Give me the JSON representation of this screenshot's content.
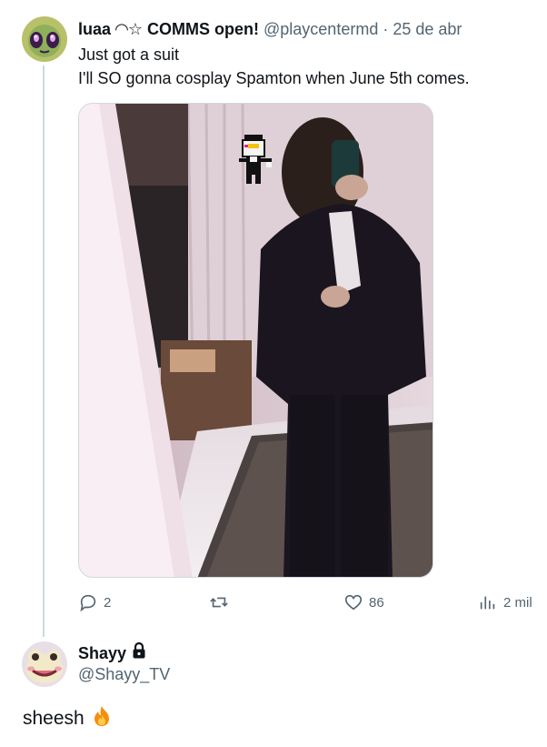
{
  "tweet": {
    "author_name": "luaa ◠☆ COMMS open!",
    "author_handle": "@playcentermd",
    "separator": "·",
    "date": "25 de abr",
    "text_line1": "Just got a suit",
    "text_line2": "I'll SO gonna cosplay Spamton when June 5th comes.",
    "media_icon": "photo",
    "actions": {
      "reply_count": "2",
      "retweet_count": "",
      "like_count": "86",
      "views_count": "2 mil"
    }
  },
  "reply": {
    "author_name": "Shayy",
    "lock_icon": "lock-icon",
    "author_handle": "@Shayy_TV",
    "text": "sheesh",
    "emoji_icon": "fire-icon"
  },
  "colors": {
    "text_primary": "#0f1419",
    "text_secondary": "#536471",
    "thread_line": "#cfd9de",
    "fire": "#f4900c"
  }
}
